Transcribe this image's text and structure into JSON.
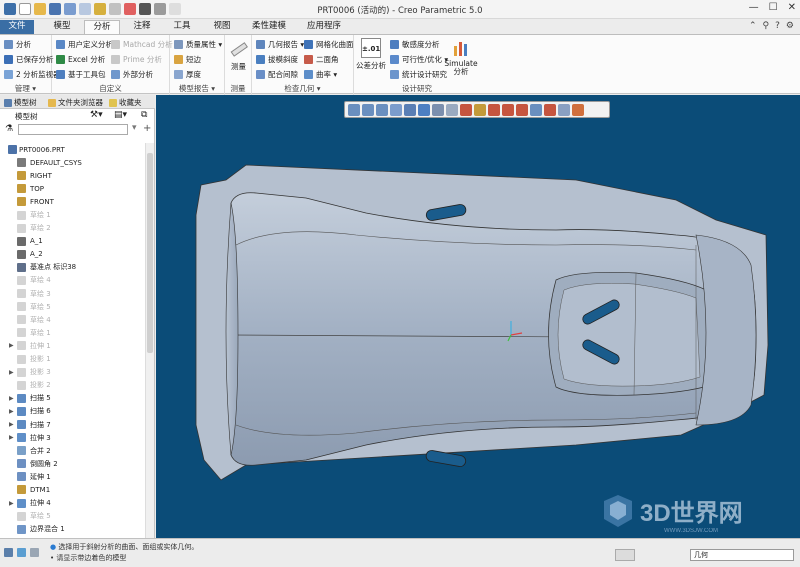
{
  "window": {
    "title": "PRT0006 (活动的) - Creo Parametric 5.0",
    "controls": [
      "—",
      "☐",
      "✕"
    ]
  },
  "tabs": [
    "文件",
    "模型",
    "分析",
    "注释",
    "工具",
    "视图",
    "柔性建模",
    "应用程序"
  ],
  "active_tab": "分析",
  "ribbon": {
    "manage": {
      "items": [
        "分析",
        "已保存分析",
        "2 分析监视器"
      ],
      "label": "管理 ▾"
    },
    "custom": {
      "items": [
        "用户定义分析",
        "Excel 分析",
        "基于工具包",
        "Mathcad 分析",
        "Prime 分析",
        "外部分析"
      ],
      "label": "自定义"
    },
    "model_report": {
      "items": [
        "质量属性 ▾",
        "短边",
        "厚度"
      ],
      "label": "模型报告 ▾"
    },
    "measure": {
      "button": "测量",
      "label": "测量"
    },
    "inspect_geometry": {
      "items": [
        "几何报告 ▾",
        "拔模斜度",
        "配合间隙",
        "网格化曲面",
        "二面角",
        "曲率 ▾"
      ],
      "label": "检查几何 ▾"
    },
    "design_study": {
      "items": [
        "公差分析",
        "敏感度分析",
        "可行性/优化 ▾",
        "统计设计研究",
        "Simulate 分析"
      ],
      "tol_icon_text": "±.01",
      "label": "设计研究"
    }
  },
  "left_panel": {
    "tabs": [
      "模型树",
      "文件夹浏览器",
      "收藏夹"
    ],
    "header": "模型树",
    "tree": [
      {
        "label": "PRT0006.PRT",
        "root": true
      },
      {
        "label": "DEFAULT_CSYS",
        "icon": "csys-icon"
      },
      {
        "label": "RIGHT",
        "icon": "datum-plane-icon"
      },
      {
        "label": "TOP",
        "icon": "datum-plane-icon"
      },
      {
        "label": "FRONT",
        "icon": "datum-plane-icon"
      },
      {
        "label": "草绘 1",
        "icon": "sketch-icon",
        "suppressed": true
      },
      {
        "label": "草绘 2",
        "icon": "sketch-icon",
        "suppressed": true
      },
      {
        "label": "A_1",
        "icon": "axis-icon"
      },
      {
        "label": "A_2",
        "icon": "axis-icon"
      },
      {
        "label": "基准点 标识38",
        "icon": "datum-point-icon"
      },
      {
        "label": "草绘 4",
        "icon": "sketch-icon",
        "suppressed": true
      },
      {
        "label": "草绘 3",
        "icon": "sketch-icon",
        "suppressed": true
      },
      {
        "label": "草绘 5",
        "icon": "sketch-icon",
        "suppressed": true
      },
      {
        "label": "草绘 4",
        "icon": "sketch-icon",
        "suppressed": true
      },
      {
        "label": "草绘 1",
        "icon": "sketch-icon",
        "suppressed": true
      },
      {
        "label": "拉伸 1",
        "icon": "extrude-icon",
        "suppressed": true,
        "arrow": true
      },
      {
        "label": "投影 1",
        "icon": "projection-icon",
        "suppressed": true
      },
      {
        "label": "投影 3",
        "icon": "projection-icon",
        "suppressed": true,
        "arrow": true
      },
      {
        "label": "投影 2",
        "icon": "projection-icon",
        "suppressed": true
      },
      {
        "label": "扫描 5",
        "icon": "sweep-icon",
        "arrow": true
      },
      {
        "label": "扫描 6",
        "icon": "sweep-icon",
        "arrow": true
      },
      {
        "label": "扫描 7",
        "icon": "sweep-icon",
        "arrow": true
      },
      {
        "label": "拉伸 3",
        "icon": "extrude-icon",
        "arrow": true
      },
      {
        "label": "合并 2",
        "icon": "merge-icon"
      },
      {
        "label": "倒圆角 2",
        "icon": "round-icon"
      },
      {
        "label": "延伸 1",
        "icon": "extend-icon"
      },
      {
        "label": "DTM1",
        "icon": "datum-plane-icon"
      },
      {
        "label": "拉伸 4",
        "icon": "extrude-icon",
        "arrow": true
      },
      {
        "label": "草绘 5",
        "icon": "sketch-icon",
        "suppressed": true
      },
      {
        "label": "边界混合 1",
        "icon": "boundary-blend-icon"
      }
    ]
  },
  "status": {
    "messages": [
      "选择用于斜射分析的曲面、面组或实体几何。",
      "•  请显示带边着色的模型"
    ],
    "selection_filter": "几何"
  },
  "watermark": {
    "text": "3D世界网",
    "url": "WWW.3DSJW.COM"
  },
  "colors": {
    "background": "#0b4c78",
    "model": "#a9b6c8",
    "file_tab": "#3a6ea5"
  }
}
